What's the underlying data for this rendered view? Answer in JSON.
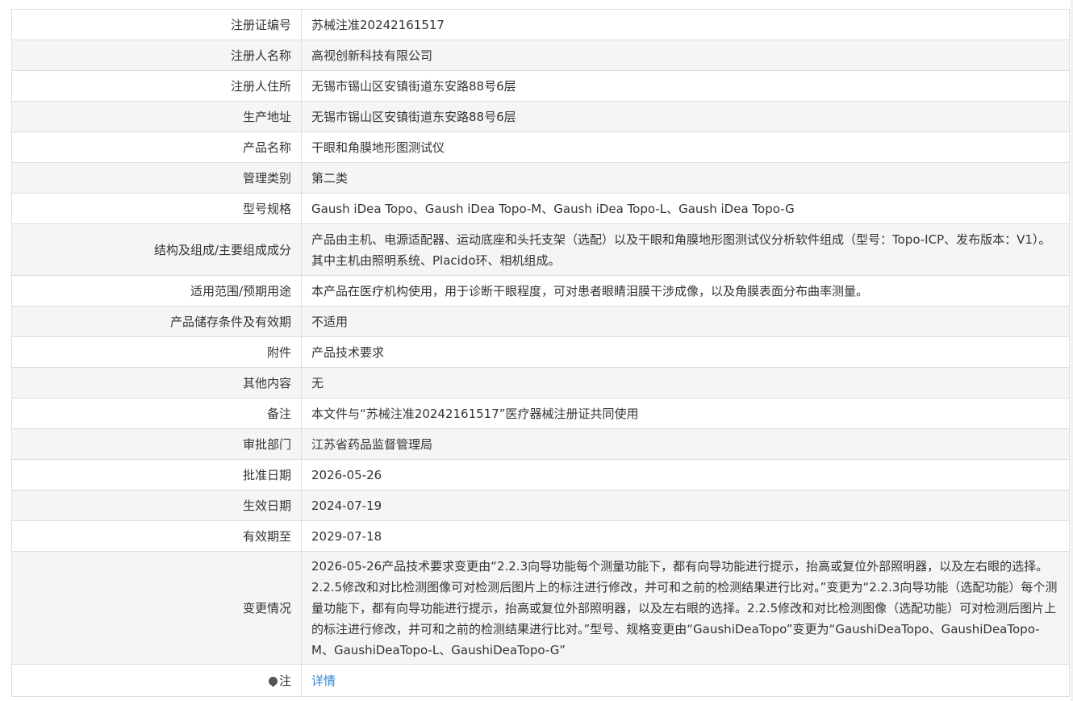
{
  "rows": [
    {
      "label": "注册证编号",
      "value": "苏械注准20242161517"
    },
    {
      "label": "注册人名称",
      "value": "高视创新科技有限公司"
    },
    {
      "label": "注册人住所",
      "value": "无锡市锡山区安镇街道东安路88号6层"
    },
    {
      "label": "生产地址",
      "value": "无锡市锡山区安镇街道东安路88号6层"
    },
    {
      "label": "产品名称",
      "value": "干眼和角膜地形图测试仪"
    },
    {
      "label": "管理类别",
      "value": "第二类"
    },
    {
      "label": "型号规格",
      "value": "Gaush iDea Topo、Gaush iDea Topo-M、Gaush iDea Topo-L、Gaush iDea Topo-G"
    },
    {
      "label": "结构及组成/主要组成成分",
      "value": "产品由主机、电源适配器、运动底座和头托支架（选配）以及干眼和角膜地形图测试仪分析软件组成（型号：Topo-ICP、发布版本：V1）。其中主机由照明系统、Placido环、相机组成。"
    },
    {
      "label": "适用范围/预期用途",
      "value": "本产品在医疗机构使用，用于诊断干眼程度，可对患者眼睛泪膜干涉成像，以及角膜表面分布曲率测量。"
    },
    {
      "label": "产品储存条件及有效期",
      "value": "不适用"
    },
    {
      "label": "附件",
      "value": "产品技术要求"
    },
    {
      "label": "其他内容",
      "value": "无"
    },
    {
      "label": "备注",
      "value": "本文件与“苏械注准20242161517”医疗器械注册证共同使用"
    },
    {
      "label": "审批部门",
      "value": "江苏省药品监督管理局"
    },
    {
      "label": "批准日期",
      "value": "2026-05-26"
    },
    {
      "label": "生效日期",
      "value": "2024-07-19"
    },
    {
      "label": "有效期至",
      "value": "2029-07-18"
    },
    {
      "label": "变更情况",
      "value": "2026-05-26产品技术要求变更由“2.2.3向导功能每个测量功能下，都有向导功能进行提示，抬高或复位外部照明器，以及左右眼的选择。2.2.5修改和对比检测图像可对检测后图片上的标注进行修改，并可和之前的检测结果进行比对。”变更为“2.2.3向导功能（选配功能）每个测量功能下，都有向导功能进行提示，抬高或复位外部照明器，以及左右眼的选择。2.2.5修改和对比检测图像（选配功能）可对检测后图片上的标注进行修改，并可和之前的检测结果进行比对。”型号、规格变更由“GaushiDeaTopo”变更为“GaushiDeaTopo、GaushiDeaTopo-M、GaushiDeaTopo-L、GaushiDeaTopo-G”"
    }
  ],
  "note": {
    "icon": "info-bulb-icon",
    "label": "注",
    "link_text": "详情",
    "link_color": "#2b84d6"
  }
}
